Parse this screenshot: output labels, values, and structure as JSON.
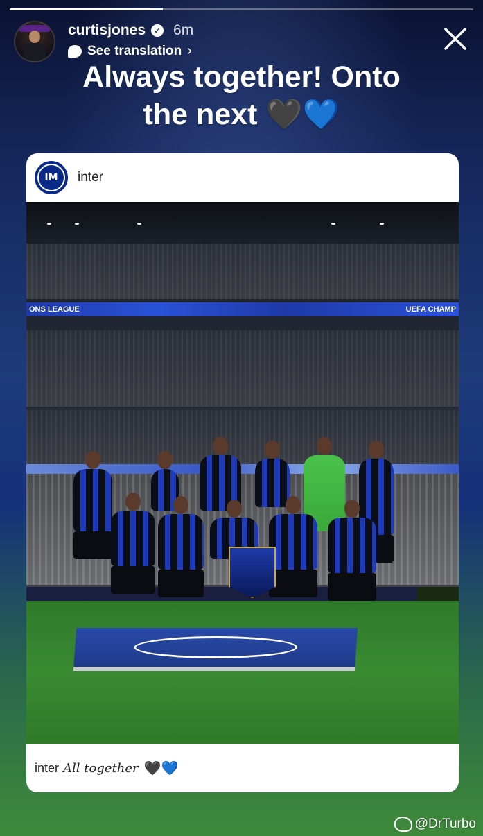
{
  "story": {
    "progress": 0.33,
    "username": "curtisjones",
    "time_ago": "6m",
    "translate_label": "See translation",
    "caption_line1": "Always together! Onto",
    "caption_line2": "the next",
    "caption_heart_black": "🖤",
    "caption_heart_blue": "💙"
  },
  "post": {
    "account": "inter",
    "account_logo": "IM",
    "stadium_led_left": "ONS LEAGUE",
    "stadium_led_right": "UEFA CHAMP",
    "caption_account": "inter",
    "caption_text": "All together",
    "caption_hearts": "🖤💙"
  },
  "watermark": {
    "text": "@DrTurbo"
  },
  "icons": {
    "verified": "verified-badge-icon",
    "translate": "translate-bubble-icon",
    "close": "close-icon",
    "weibo": "weibo-logo-icon"
  }
}
